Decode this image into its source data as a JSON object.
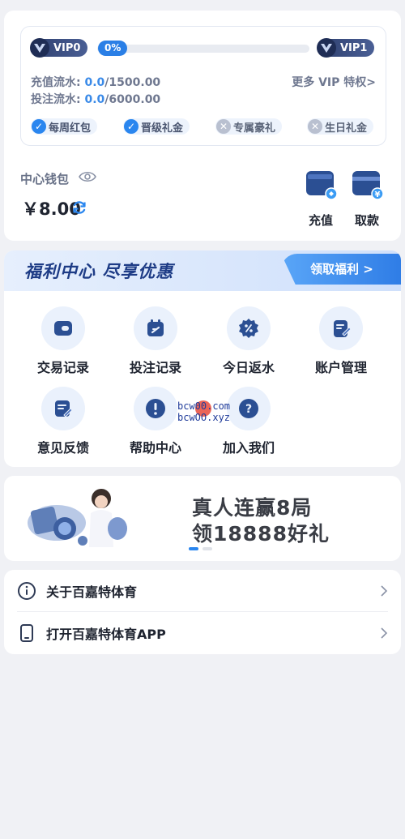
{
  "vip": {
    "current_level": "VIP0",
    "next_level": "VIP1",
    "progress_label": "0%",
    "progress_fraction": 0,
    "deposit_label": "充值流水: ",
    "deposit_current": "0.0",
    "deposit_target": "/1500.00",
    "bet_label": "投注流水: ",
    "bet_current": "0.0",
    "bet_target": "/6000.00",
    "more_link": "更多 VIP 特权>",
    "perks": [
      {
        "label": "每周红包",
        "enabled": true
      },
      {
        "label": "晋级礼金",
        "enabled": true
      },
      {
        "label": "专属豪礼",
        "enabled": false
      },
      {
        "label": "生日礼金",
        "enabled": false
      }
    ]
  },
  "wallet": {
    "label": "中心钱包",
    "balance": "￥8.00",
    "actions": [
      {
        "label": "充值",
        "icon": "wallet-deposit-icon"
      },
      {
        "label": "取款",
        "icon": "card-withdraw-icon"
      }
    ]
  },
  "welfare": {
    "title": "福利中心 尽享优惠",
    "button": "领取福利 >",
    "items": [
      {
        "label": "交易记录",
        "icon": "wallet-icon"
      },
      {
        "label": "投注记录",
        "icon": "calendar-icon"
      },
      {
        "label": "今日返水",
        "icon": "percent-badge-icon"
      },
      {
        "label": "账户管理",
        "icon": "edit-document-icon"
      },
      {
        "label": "意见反馈",
        "icon": "feedback-icon"
      },
      {
        "label": "帮助中心",
        "icon": "exclamation-icon"
      },
      {
        "label": "加入我们",
        "icon": "question-icon"
      }
    ],
    "watermark_line1": "bcw00.com",
    "watermark_line2": "bcwOO.xyz"
  },
  "promo": {
    "line1": "真人连赢8局",
    "line2": "领18888好礼",
    "slides": 2,
    "active_slide": 0
  },
  "links": [
    {
      "label": "关于百嘉特体育",
      "icon": "info-icon"
    },
    {
      "label": "打开百嘉特体育APP",
      "icon": "phone-icon"
    }
  ],
  "colors": {
    "accent": "#2a86ef",
    "dark_navy": "#2e3f6e",
    "background": "#f0f1f5"
  }
}
